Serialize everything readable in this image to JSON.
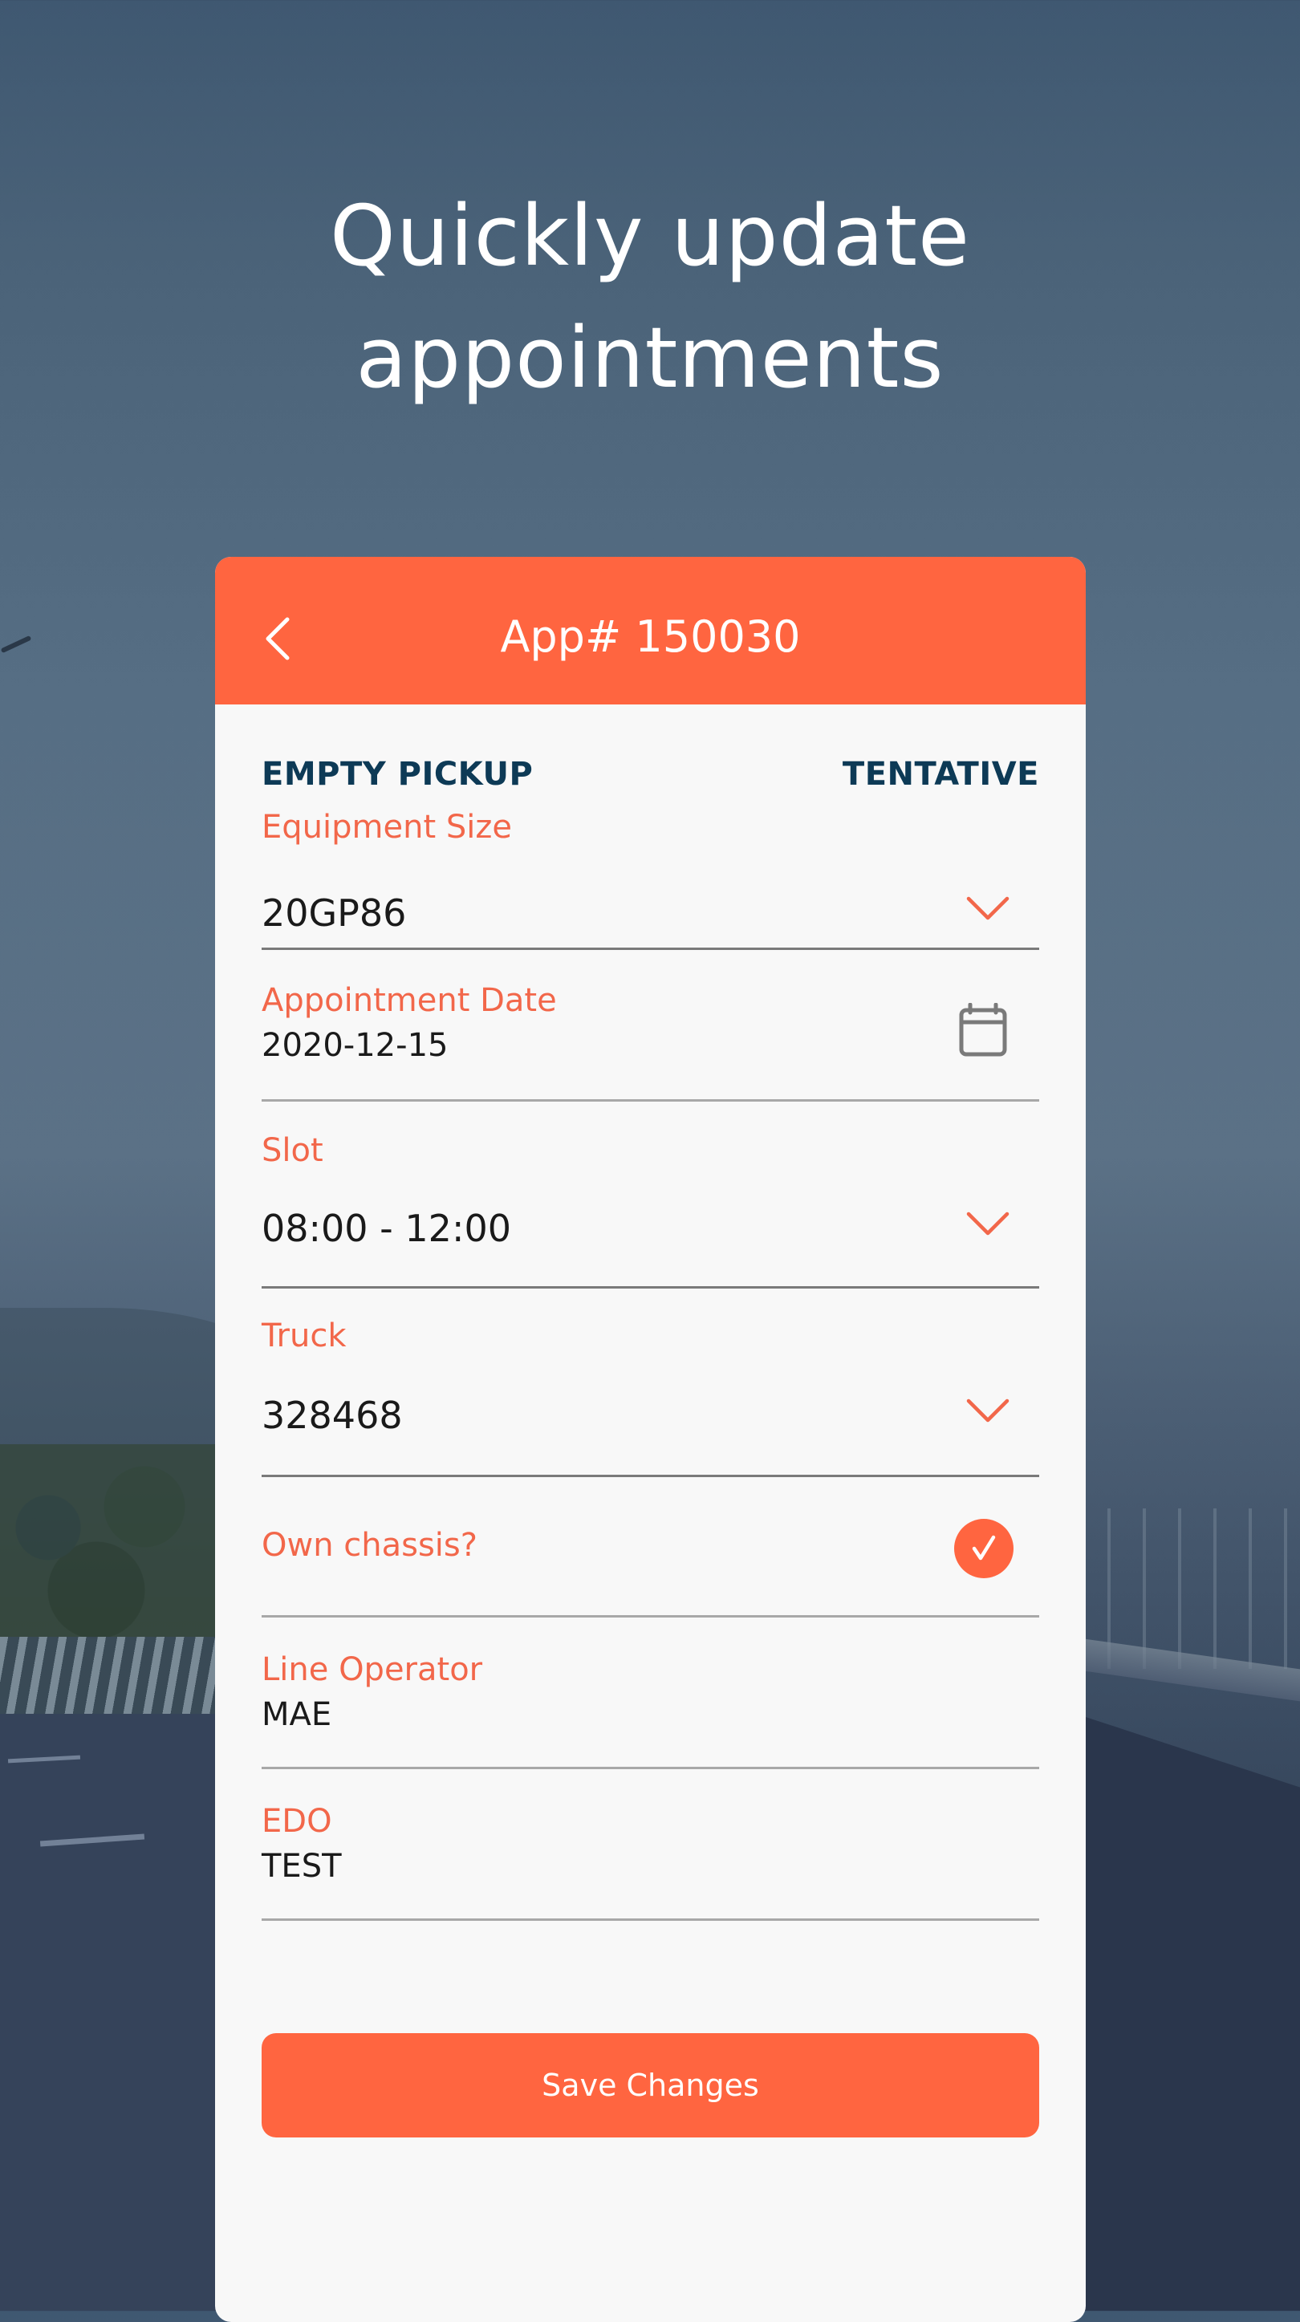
{
  "promo": {
    "headline_line1": "Quickly update",
    "headline_line2": "appointments"
  },
  "header": {
    "title": "App# 150030",
    "back_icon": "chevron-left-icon"
  },
  "appointment": {
    "type": "EMPTY PICKUP",
    "status": "TENTATIVE"
  },
  "fields": {
    "equipment_size": {
      "label": "Equipment Size",
      "value": "20GP86",
      "icon": "chevron-down-icon"
    },
    "appointment_date": {
      "label": "Appointment Date",
      "value": "2020-12-15",
      "icon": "calendar-icon"
    },
    "slot": {
      "label": "Slot",
      "value": "08:00 - 12:00",
      "icon": "chevron-down-icon"
    },
    "truck": {
      "label": "Truck",
      "value": "328468",
      "icon": "chevron-down-icon"
    },
    "own_chassis": {
      "label": "Own chassis?",
      "checked": true,
      "icon": "check-circle-icon"
    },
    "line_operator": {
      "label": "Line Operator",
      "value": "MAE"
    },
    "edo": {
      "label": "EDO",
      "value": "TEST"
    }
  },
  "actions": {
    "save_label": "Save Changes"
  },
  "colors": {
    "accent": "#ff6540",
    "label": "#f2674a",
    "status_text": "#0d3a56",
    "card_bg": "#f8f8f8"
  }
}
